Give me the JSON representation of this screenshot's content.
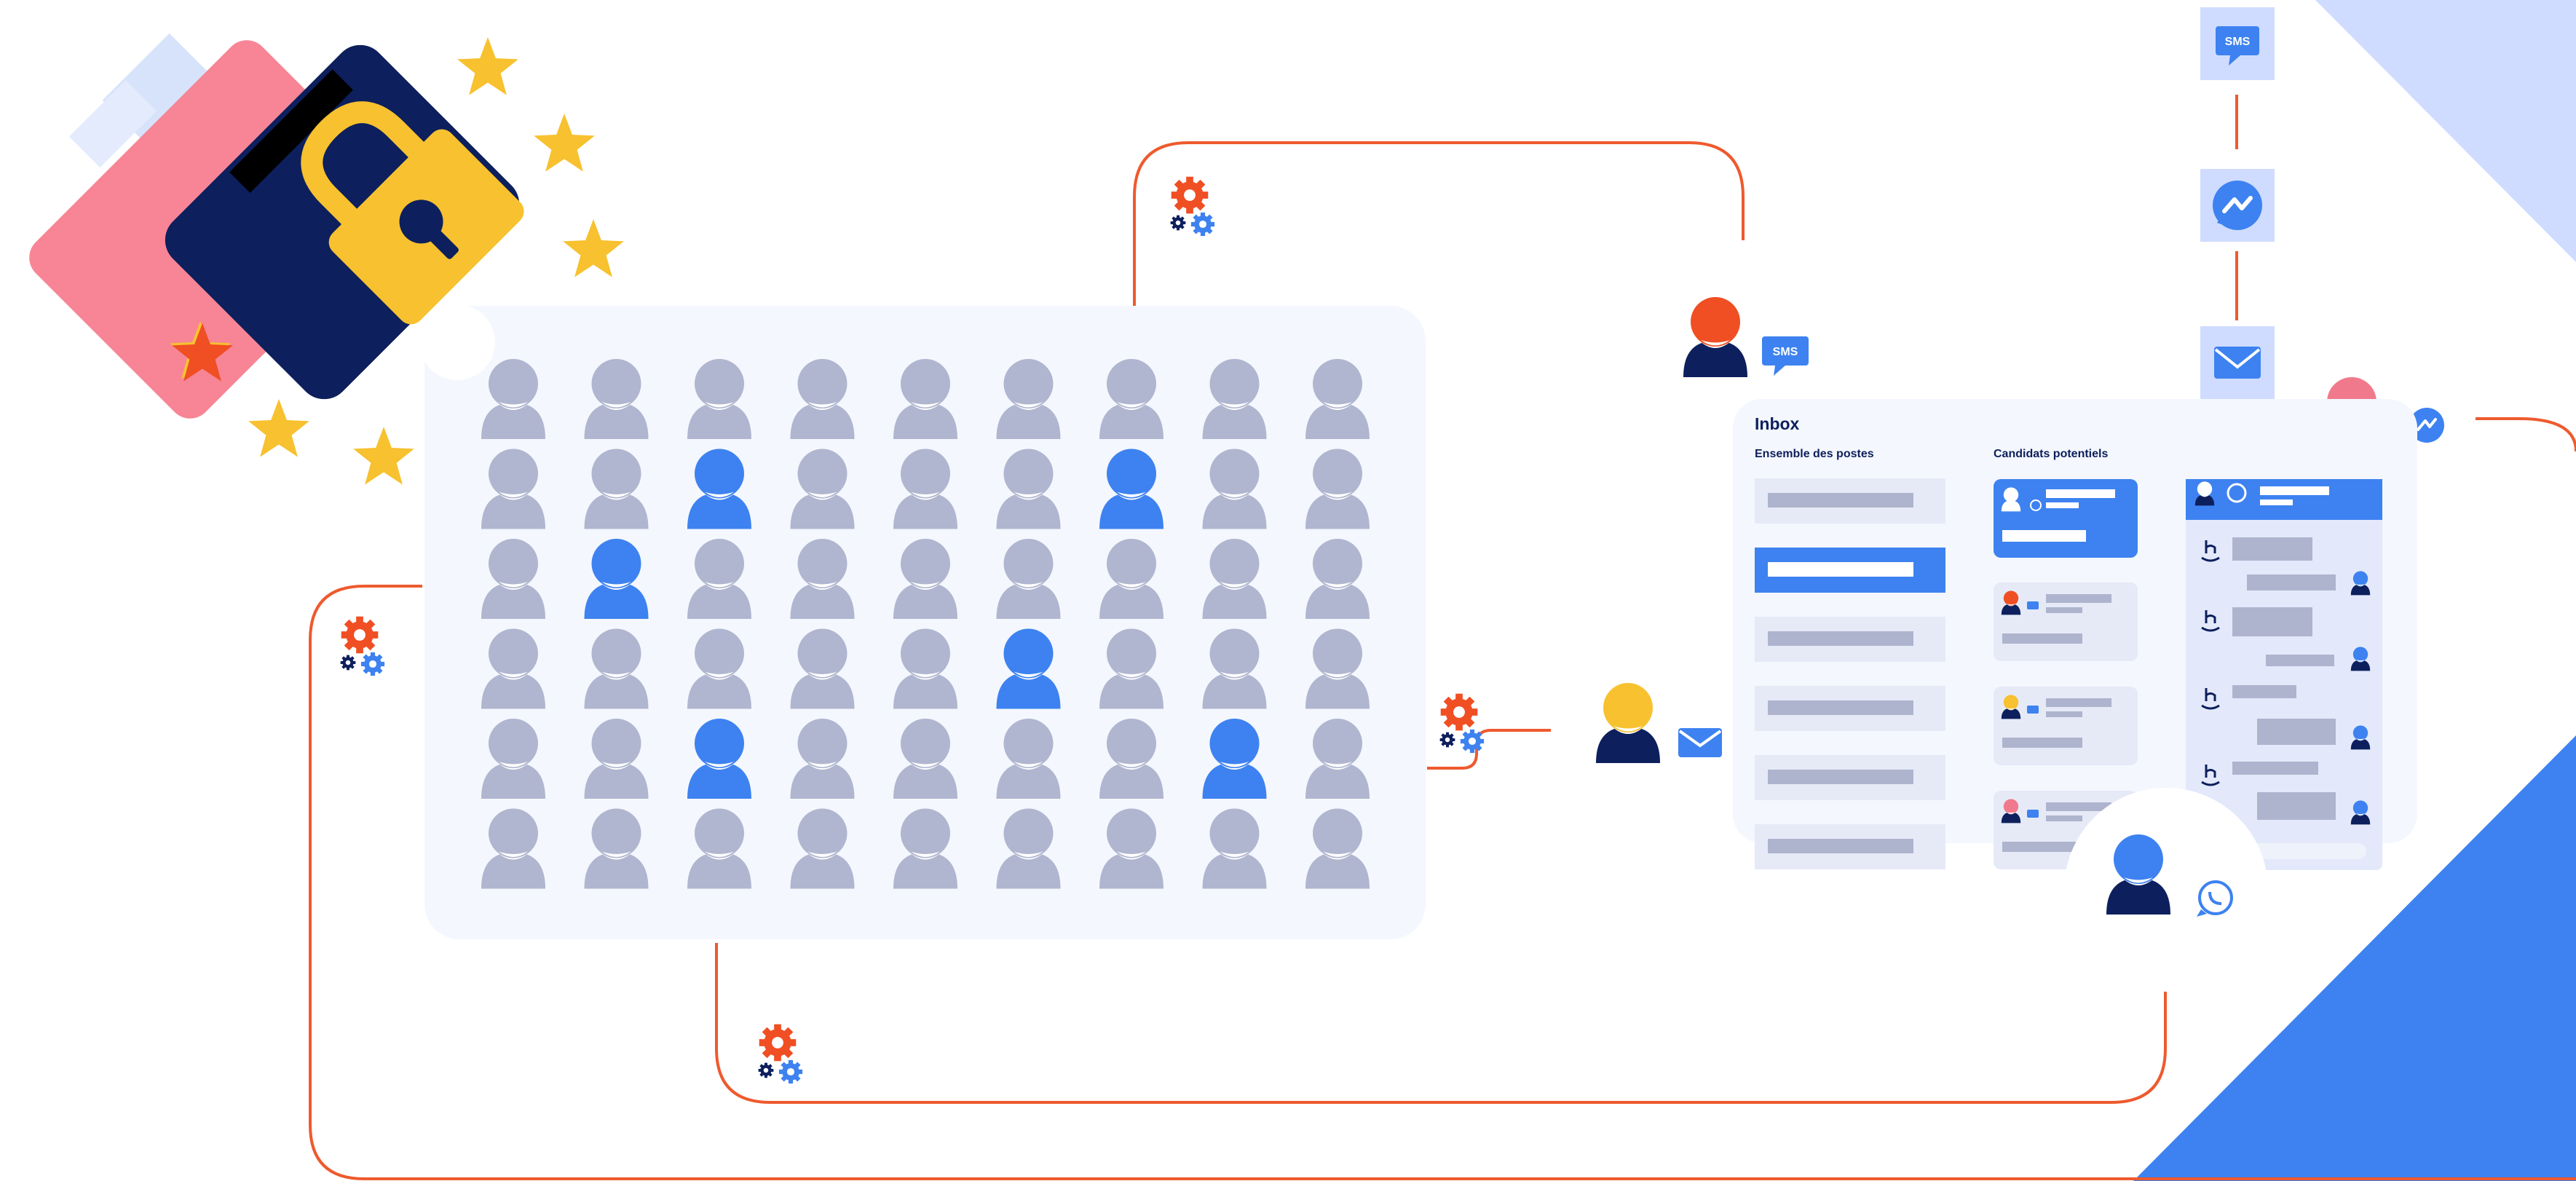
{
  "colors": {
    "navy": "#0d1f5c",
    "blue": "#3d82f0",
    "light_blue": "#cfdcff",
    "pale_blue": "#e3e9fb",
    "panel_bg": "#f4f7fd",
    "gray_person": "#b0b6cf",
    "orange": "#f04e23",
    "red_line": "#ee5a2e",
    "yellow": "#f7c12f",
    "pink": "#f78595",
    "pink_head": "#f07a8c",
    "skeleton": "#aeb4cd",
    "skeleton_bg": "#e6eaf7"
  },
  "population_grid": {
    "rows": 6,
    "columns": 9,
    "highlighted": [
      [
        1,
        2
      ],
      [
        1,
        6
      ],
      [
        2,
        1
      ],
      [
        3,
        5
      ],
      [
        4,
        2
      ],
      [
        4,
        7
      ]
    ]
  },
  "inbox": {
    "title": "Inbox",
    "col_all_jobs": "Ensemble des postes",
    "col_candidates": "Candidats potentiels"
  },
  "badges": {
    "sms": "SMS"
  },
  "icons": [
    "sms-icon",
    "messenger-icon",
    "email-icon",
    "whatsapp-icon",
    "gear-icon",
    "lock-icon",
    "star-icon",
    "wallet-icon",
    "person-icon"
  ]
}
